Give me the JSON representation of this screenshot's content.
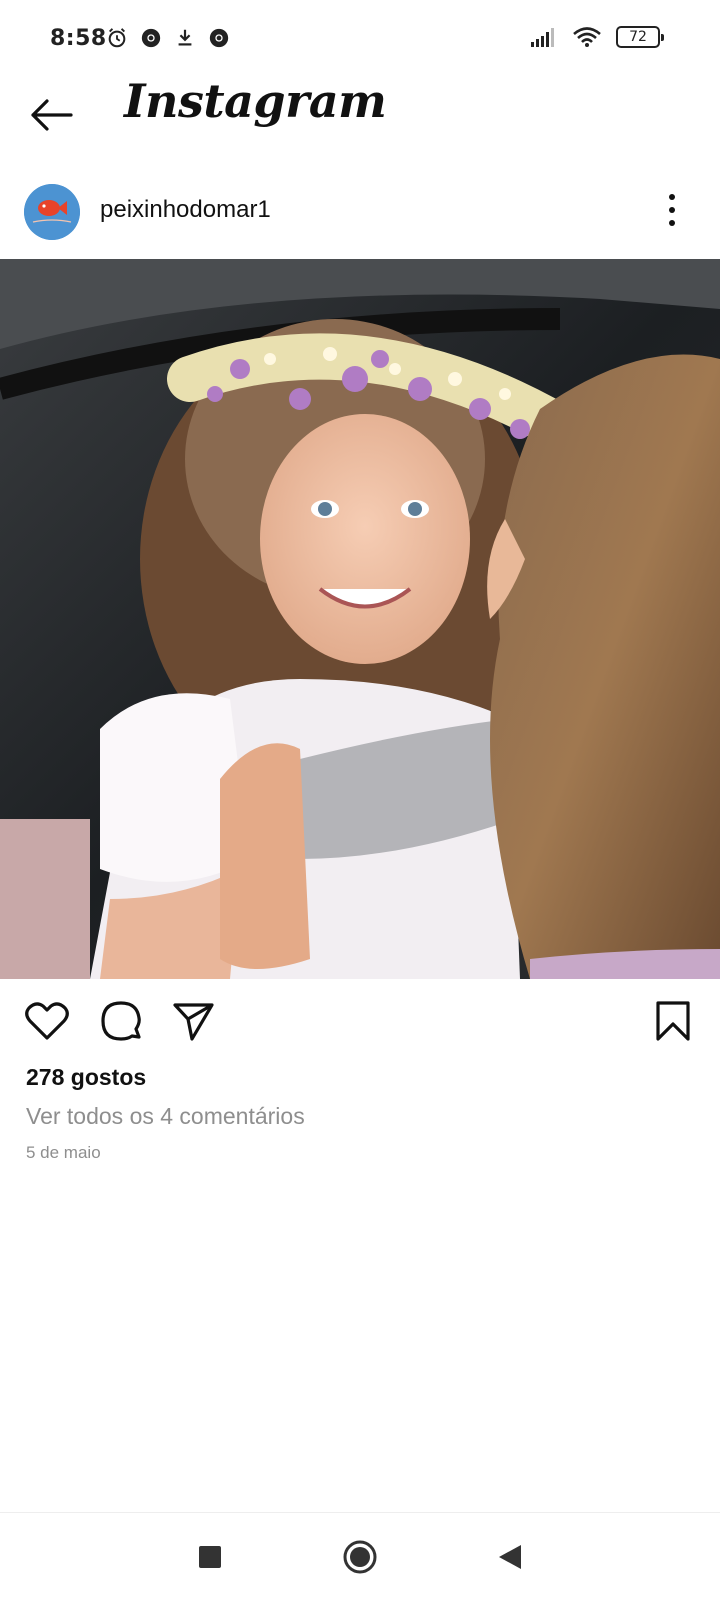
{
  "status_bar": {
    "time": "8:58",
    "battery": "72",
    "icons": [
      "alarm-icon",
      "chrome-icon",
      "download-icon",
      "chrome-icon",
      "signal-icon",
      "wifi-icon",
      "battery-icon"
    ]
  },
  "header": {
    "title": "Instagram",
    "back_icon": "back-arrow-icon"
  },
  "post": {
    "username": "peixinhodomar1",
    "avatar_text": "Peixinho do mar",
    "likes": "278 gostos",
    "comments_link": "Ver todos os 4 comentários",
    "date": "5 de maio"
  },
  "actions": {
    "icons": [
      "heart-icon",
      "comment-icon",
      "send-icon",
      "bookmark-icon"
    ]
  },
  "nav_bar": {
    "icons": [
      "recents-square-icon",
      "home-circle-icon",
      "back-triangle-icon"
    ]
  },
  "colors": {
    "text": "#111111",
    "secondary_text": "#8e8e8e",
    "avatar_bg": "#4c93d2",
    "fish": "#e8432a"
  }
}
